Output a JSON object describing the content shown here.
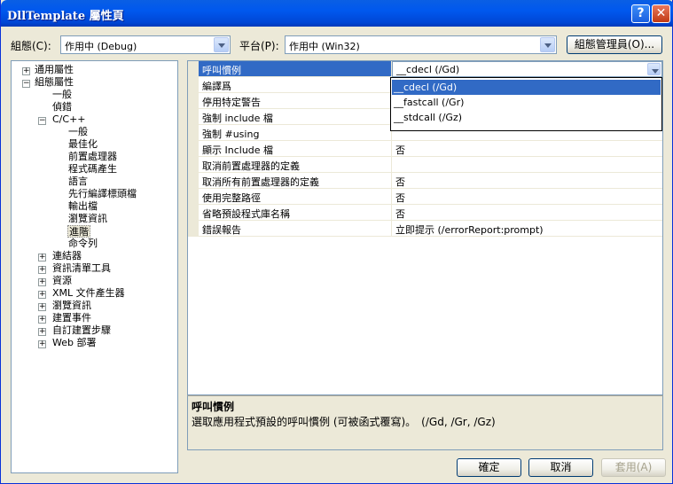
{
  "window": {
    "title": "DllTemplate 屬性頁",
    "help": "?",
    "close": "✕"
  },
  "toolbar": {
    "config_label": "組態(C):",
    "config_value": "作用中 (Debug)",
    "platform_label": "平台(P):",
    "platform_value": "作用中 (Win32)",
    "config_manager": "組態管理員(O)..."
  },
  "tree": {
    "n0": "通用屬性",
    "n1": "組態屬性",
    "n2": "一般",
    "n3": "偵錯",
    "n4": "C/C++",
    "n5": "一般",
    "n6": "最佳化",
    "n7": "前置處理器",
    "n8": "程式碼產生",
    "n9": "語言",
    "n10": "先行編譯標頭檔",
    "n11": "輸出檔",
    "n12": "瀏覽資訊",
    "n13": "進階",
    "n14": "命令列",
    "n15": "連結器",
    "n16": "資訊清單工具",
    "n17": "資源",
    "n18": "XML 文件產生器",
    "n19": "瀏覽資訊",
    "n20": "建置事件",
    "n21": "自訂建置步驟",
    "n22": "Web 部署"
  },
  "grid": [
    {
      "name": "呼叫慣例",
      "value": "__cdecl (/Gd)"
    },
    {
      "name": "編譯爲",
      "value": ""
    },
    {
      "name": "停用特定警告",
      "value": ""
    },
    {
      "name": "強制 include 檔",
      "value": ""
    },
    {
      "name": "強制 #using",
      "value": ""
    },
    {
      "name": "顯示 Include 檔",
      "value": "否"
    },
    {
      "name": "取消前置處理器的定義",
      "value": ""
    },
    {
      "name": "取消所有前置處理器的定義",
      "value": "否"
    },
    {
      "name": "使用完整路徑",
      "value": "否"
    },
    {
      "name": "省略預設程式庫名稱",
      "value": "否"
    },
    {
      "name": "錯誤報告",
      "value": "立即提示 (/errorReport:prompt)"
    }
  ],
  "dropdown": [
    "__cdecl (/Gd)",
    "__fastcall (/Gr)",
    "__stdcall (/Gz)"
  ],
  "description": {
    "title": "呼叫慣例",
    "text": "選取應用程式預設的呼叫慣例 (可被函式覆寫)。　(/Gd, /Gr, /Gz)"
  },
  "buttons": {
    "ok": "確定",
    "cancel": "取消",
    "apply": "套用(A)"
  }
}
